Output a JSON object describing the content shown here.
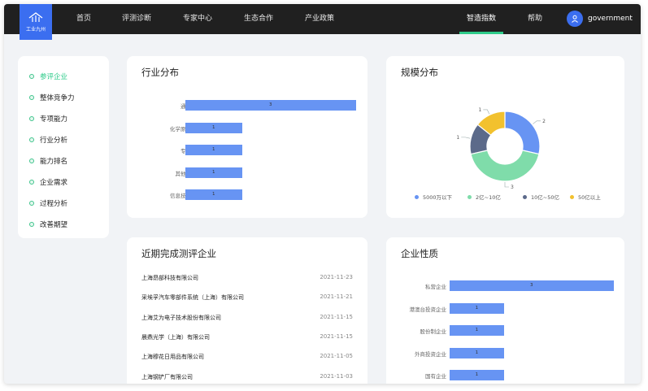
{
  "header": {
    "logo_text": "工业九州",
    "nav": [
      "首页",
      "评测诊断",
      "专家中心",
      "生态合作",
      "产业政策",
      "智造指数",
      "帮助"
    ],
    "active_nav": "智造指数",
    "user_name": "government"
  },
  "sidebar": {
    "items": [
      {
        "label": "参评企业",
        "active": true
      },
      {
        "label": "整体竞争力",
        "active": false
      },
      {
        "label": "专项能力",
        "active": false
      },
      {
        "label": "行业分析",
        "active": false
      },
      {
        "label": "能力排名",
        "active": false
      },
      {
        "label": "企业需求",
        "active": false
      },
      {
        "label": "过程分析",
        "active": false
      },
      {
        "label": "改善期望",
        "active": false
      }
    ]
  },
  "industry": {
    "title": "行业分布",
    "chart_data": {
      "type": "bar",
      "orientation": "horizontal",
      "categories": [
        "通用设备",
        "化学原料制品",
        "专用设备",
        "其他制造业",
        "信息技术服务"
      ],
      "values": [
        3,
        1,
        1,
        1,
        1
      ],
      "xlim": [
        0,
        3
      ]
    }
  },
  "scale": {
    "title": "规模分布",
    "chart_data": {
      "type": "pie",
      "donut": true,
      "labels": [
        "5000万以下",
        "2亿~10亿",
        "10亿~50亿",
        "50亿以上"
      ],
      "values": [
        2,
        3,
        1,
        1
      ],
      "colors": [
        "#6794f3",
        "#7fdcaa",
        "#5c6a8a",
        "#f2c12e"
      ]
    }
  },
  "recent": {
    "title": "近期完成测评企业",
    "rows": [
      {
        "name": "上海昂部科技有限公司",
        "date": "2021-11-23"
      },
      {
        "name": "采埃孚汽车零部件系统（上海）有限公司",
        "date": "2021-11-21"
      },
      {
        "name": "上海艾为电子技术股份有限公司",
        "date": "2021-11-15"
      },
      {
        "name": "晨鼎光学（上海）有限公司",
        "date": "2021-11-15"
      },
      {
        "name": "上海穆花日用品有限公司",
        "date": "2021-11-05"
      },
      {
        "name": "上海钢铲厂有限公司",
        "date": "2021-11-03"
      }
    ]
  },
  "nature": {
    "title": "企业性质",
    "chart_data": {
      "type": "bar",
      "orientation": "horizontal",
      "categories": [
        "私营企业",
        "港澳台投资企业",
        "股份制企业",
        "外商投资企业",
        "国有企业"
      ],
      "values": [
        3,
        1,
        1,
        1,
        1
      ],
      "xlim": [
        0,
        3
      ]
    }
  },
  "colors": {
    "accent": "#2ecb8a",
    "bar": "#6794f3",
    "brand": "#3b6ef0",
    "topbar": "#202020"
  }
}
